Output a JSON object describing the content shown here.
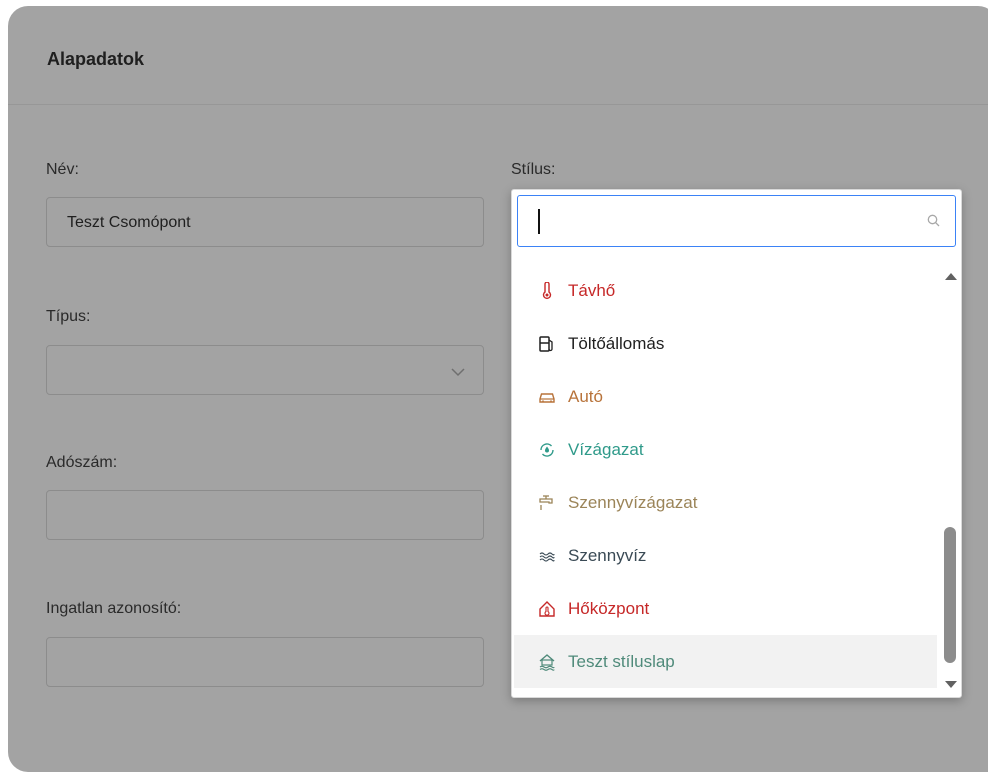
{
  "card": {
    "title": "Alapadatok"
  },
  "form": {
    "name_label": "Név:",
    "name_value": "Teszt Csomópont",
    "type_label": "Típus:",
    "tax_label": "Adószám:",
    "property_label": "Ingatlan azonosító:",
    "style_label": "Stílus:"
  },
  "dropdown": {
    "search_value": "",
    "options": [
      {
        "label": "Távhő",
        "color": "#c62828",
        "icon": "thermometer-icon"
      },
      {
        "label": "Töltőállomás",
        "color": "#1f1f1f",
        "icon": "fuel-station-icon"
      },
      {
        "label": "Autó",
        "color": "#b8733a",
        "icon": "car-icon"
      },
      {
        "label": "Vízágazat",
        "color": "#2f9a8a",
        "icon": "water-cycle-icon"
      },
      {
        "label": "Szennyvízágazat",
        "color": "#9b8458",
        "icon": "faucet-icon"
      },
      {
        "label": "Szennyvíz",
        "color": "#3a4a55",
        "icon": "waves-icon"
      },
      {
        "label": "Hőközpont",
        "color": "#c62828",
        "icon": "heat-house-icon"
      },
      {
        "label": "Teszt stíluslap",
        "color": "#4f8a7a",
        "icon": "house-water-icon"
      }
    ]
  },
  "colors": {
    "overlay": "#a3a3a3",
    "focus_border": "#3b82f6",
    "highlight": "#f2f2f2"
  }
}
